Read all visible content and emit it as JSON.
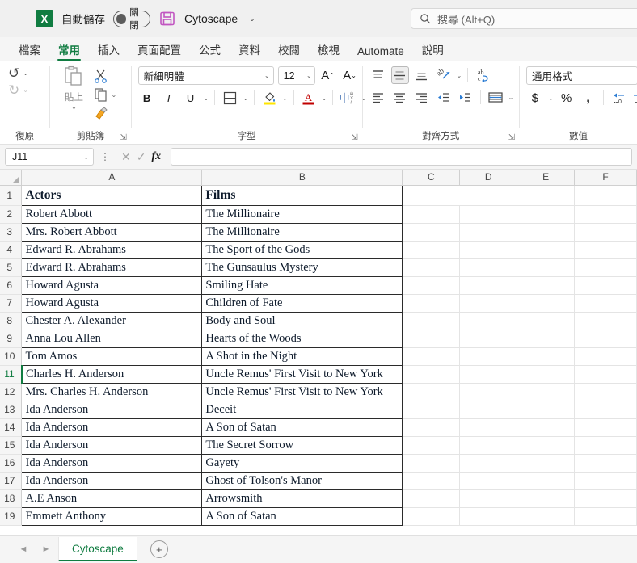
{
  "titlebar": {
    "app_icon": "excel-icon",
    "autosave_label": "自動儲存",
    "autosave_state": "關閉",
    "save_icon": "save-icon",
    "filename": "Cytoscape",
    "filename_chevron": "⌄"
  },
  "search": {
    "icon": "search-icon",
    "placeholder": "搜尋 (Alt+Q)"
  },
  "ribbon_tabs": [
    {
      "label": "檔案",
      "active": false
    },
    {
      "label": "常用",
      "active": true
    },
    {
      "label": "插入",
      "active": false
    },
    {
      "label": "頁面配置",
      "active": false
    },
    {
      "label": "公式",
      "active": false
    },
    {
      "label": "資料",
      "active": false
    },
    {
      "label": "校閱",
      "active": false
    },
    {
      "label": "檢視",
      "active": false
    },
    {
      "label": "Automate",
      "active": false
    },
    {
      "label": "說明",
      "active": false
    }
  ],
  "ribbon": {
    "undo": {
      "label": "復原",
      "undo_icon": "undo-arrow-icon",
      "redo_icon": "redo-arrow-icon",
      "chevron": "⌄"
    },
    "clipboard": {
      "label": "剪貼簿",
      "paste_label": "貼上",
      "paste_icon": "paste-icon",
      "cut_icon": "scissors-icon",
      "copy_icon": "copy-icon",
      "format_painter_icon": "format-painter-icon",
      "chevron": "⌄",
      "dialog_launcher": "⇲"
    },
    "font": {
      "label": "字型",
      "font_name": "新細明體",
      "font_size": "12",
      "grow_font": "A",
      "shrink_font": "A",
      "bold": "B",
      "italic": "I",
      "underline": "U",
      "borders_icon": "borders-icon",
      "fill_color_icon": "fill-color-icon",
      "font_color_icon": "font-color-icon",
      "phonetic_icon": "phonetic-guide-icon",
      "chevron": "⌄",
      "dialog_launcher": "⇲"
    },
    "alignment": {
      "label": "對齊方式",
      "align_top_icon": "align-top-icon",
      "align_middle_icon": "align-middle-icon",
      "align_bottom_icon": "align-bottom-icon",
      "orientation_icon": "text-orientation-icon",
      "wrap_text_icon": "wrap-text-icon",
      "align_left_icon": "align-left-icon",
      "align_center_icon": "align-center-icon",
      "align_right_icon": "align-right-icon",
      "decrease_indent_icon": "decrease-indent-icon",
      "increase_indent_icon": "increase-indent-icon",
      "merge_cells_icon": "merge-cells-icon",
      "chevron": "⌄",
      "dialog_launcher": "⇲"
    },
    "number": {
      "label": "數值",
      "format": "通用格式",
      "currency_icon": "$",
      "percent_icon": "%",
      "comma_icon": "comma-style-icon",
      "decrease_decimal_icon": "decrease-decimal-icon",
      "increase_decimal_icon": "increase-decimal-icon",
      "chevron": "⌄"
    }
  },
  "formula_bar": {
    "name_box": "J11",
    "name_box_chevron": "⌄",
    "more_icon": "⋮",
    "cancel_icon": "✕",
    "enter_icon": "✓",
    "fx_icon": "fx",
    "value": ""
  },
  "grid": {
    "column_headers": [
      "A",
      "B",
      "C",
      "D",
      "E",
      "F"
    ],
    "active_row": 11,
    "rows": [
      {
        "n": 1,
        "a": "Actors",
        "b": "Films"
      },
      {
        "n": 2,
        "a": "Robert Abbott",
        "b": "The Millionaire"
      },
      {
        "n": 3,
        "a": "Mrs. Robert Abbott",
        "b": "The Millionaire"
      },
      {
        "n": 4,
        "a": "Edward R. Abrahams",
        "b": "The Sport of the Gods"
      },
      {
        "n": 5,
        "a": "Edward R. Abrahams",
        "b": "The Gunsaulus Mystery"
      },
      {
        "n": 6,
        "a": "Howard Agusta",
        "b": "Smiling Hate"
      },
      {
        "n": 7,
        "a": "Howard Agusta",
        "b": "Children of Fate"
      },
      {
        "n": 8,
        "a": "Chester A. Alexander",
        "b": "Body and Soul"
      },
      {
        "n": 9,
        "a": "Anna Lou Allen",
        "b": "Hearts of the Woods"
      },
      {
        "n": 10,
        "a": "Tom Amos",
        "b": "A Shot in the Night"
      },
      {
        "n": 11,
        "a": "Charles H. Anderson",
        "b": "Uncle Remus' First Visit to New York"
      },
      {
        "n": 12,
        "a": "Mrs. Charles H. Anderson",
        "b": "Uncle Remus' First Visit to New York"
      },
      {
        "n": 13,
        "a": "Ida Anderson",
        "b": "Deceit"
      },
      {
        "n": 14,
        "a": "Ida Anderson",
        "b": "A Son of Satan"
      },
      {
        "n": 15,
        "a": "Ida Anderson",
        "b": "The Secret Sorrow"
      },
      {
        "n": 16,
        "a": "Ida Anderson",
        "b": "Gayety"
      },
      {
        "n": 17,
        "a": "Ida Anderson",
        "b": "Ghost of Tolson's Manor"
      },
      {
        "n": 18,
        "a": "A.E Anson",
        "b": "Arrowsmith"
      },
      {
        "n": 19,
        "a": "Emmett Anthony",
        "b": "A Son of Satan"
      }
    ]
  },
  "sheetbar": {
    "prev_icon": "◄",
    "next_icon": "►",
    "sheet_name": "Cytoscape",
    "add_sheet_icon": "+"
  },
  "colors": {
    "excel_green": "#107c41",
    "save_purple": "#c156c1",
    "accent_blue": "#1a6fc4"
  }
}
